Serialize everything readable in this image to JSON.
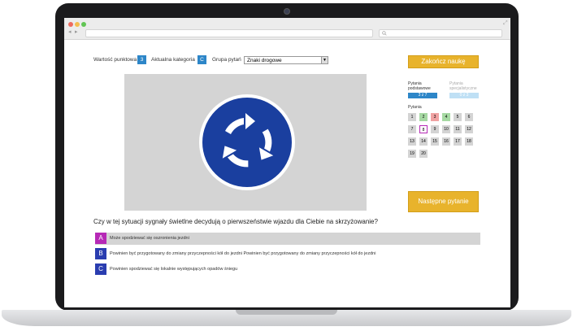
{
  "header": {
    "points_label": "Wartość punktowa",
    "points_value": "3",
    "category_label": "Aktualna kategoria",
    "category_value": "C",
    "group_label": "Grupa pytań",
    "group_selected": "Znaki drogowe"
  },
  "question": {
    "text": "Czy w tej sytuacji sygnały świetlne decydują o pierwszeństwie wjazdu dla Ciebie na skrzyżowanie?"
  },
  "answers": [
    {
      "letter": "A",
      "text": "Może spodziewać się oszronienia jezdni"
    },
    {
      "letter": "B",
      "text": "Powinien być przygotowany do zmiany przyczepności kół do jezdni Powinien być przygotowany do zmiany przyczepności kół do jezdni"
    },
    {
      "letter": "C",
      "text": "Powinien spodziewać się lokalnie występujących opadów śniegu"
    }
  ],
  "sidebar": {
    "finish_label": "Zakończ naukę",
    "basic_label": "Pytania podstawowe",
    "basic_progress": "3 z 7",
    "special_label": "Pytania specjalistyczne",
    "special_progress": "0 z 3",
    "questions_label": "Pytania",
    "question_numbers": [
      "1",
      "2",
      "3",
      "4",
      "5",
      "6",
      "7",
      "8",
      "9",
      "10",
      "11",
      "12",
      "13",
      "14",
      "15",
      "16",
      "17",
      "18",
      "19",
      "20"
    ],
    "next_label": "Następne pytanie"
  },
  "colors": {
    "accent_blue": "#2d86c8",
    "selected_purple": "#b629b6",
    "answer_blue": "#2a3db0",
    "finish_yellow": "#e8b32c",
    "correct_green": "#a6d9a3",
    "wrong_red": "#f0a2a2"
  }
}
